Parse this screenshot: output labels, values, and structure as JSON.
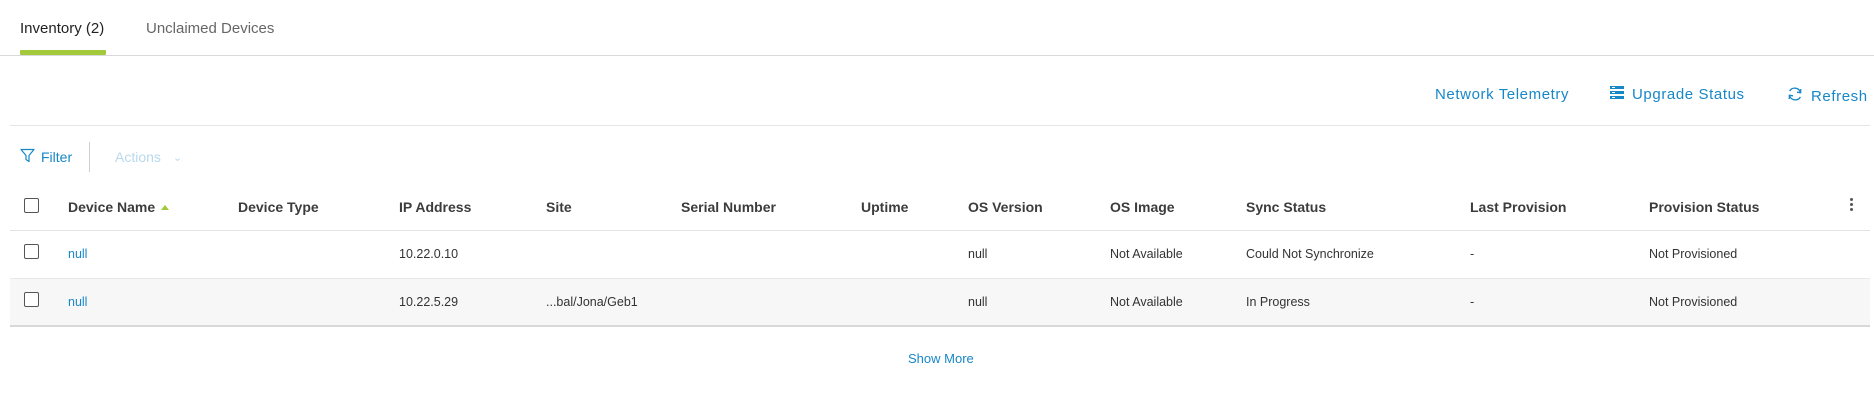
{
  "tabs": [
    {
      "label": "Inventory  (2)",
      "active": true
    },
    {
      "label": "Unclaimed Devices",
      "active": false
    }
  ],
  "top_actions": {
    "network_telemetry": "Network Telemetry",
    "upgrade_status": "Upgrade Status",
    "refresh": "Refresh"
  },
  "filter_bar": {
    "filter": "Filter",
    "actions": "Actions"
  },
  "table": {
    "columns": [
      "Device Name",
      "Device Type",
      "IP Address",
      "Site",
      "Serial Number",
      "Uptime",
      "OS Version",
      "OS Image",
      "Sync Status",
      "Last Provision",
      "Provision Status"
    ],
    "rows": [
      {
        "device_name": "null",
        "device_type": "",
        "ip_address": "10.22.0.10",
        "site": "",
        "serial_number": "",
        "uptime": "",
        "os_version": "null",
        "os_image": "Not Available",
        "sync_status": "Could Not Synchronize",
        "last_provision": "-",
        "provision_status": "Not Provisioned"
      },
      {
        "device_name": "null",
        "device_type": "",
        "ip_address": "10.22.5.29",
        "site": "...bal/Jona/Geb1",
        "serial_number": "",
        "uptime": "",
        "os_version": "null",
        "os_image": "Not Available",
        "sync_status": "In Progress",
        "last_provision": "-",
        "provision_status": "Not Provisioned"
      }
    ]
  },
  "show_more": "Show More",
  "colors": {
    "accent": "#1787c8",
    "tab_underline": "#a2c93a"
  },
  "icons": [
    "filter-icon",
    "upgrade-status-icon",
    "refresh-icon",
    "chevron-down-icon",
    "sort-asc-icon",
    "kebab-menu-icon"
  ]
}
